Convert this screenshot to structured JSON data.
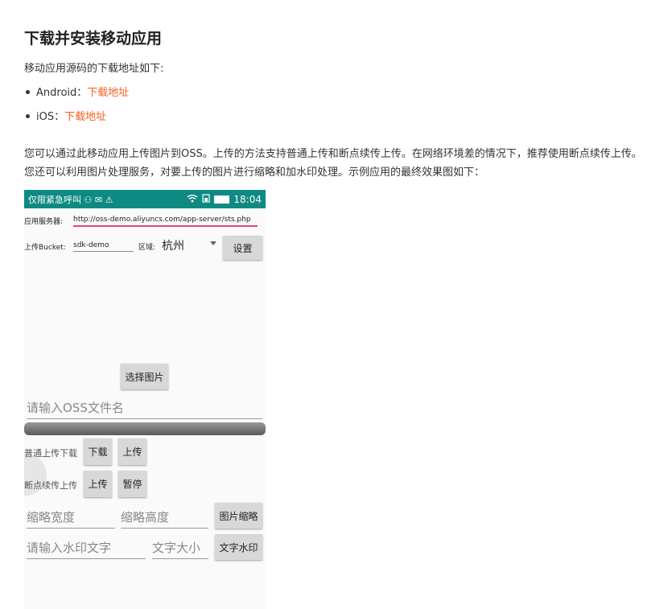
{
  "doc": {
    "heading": "下载并安装移动应用",
    "intro": "移动应用源码的下载地址如下:",
    "links": [
      {
        "platform": "Android：",
        "link": "下载地址"
      },
      {
        "platform": "iOS：",
        "link": "下载地址"
      }
    ],
    "description": "您可以通过此移动应用上传图片到OSS。上传的方法支持普通上传和断点续传上传。在网络环境差的情况下，推荐使用断点续传上传。您还可以利用图片处理服务，对要上传的图片进行缩略和加水印处理。示例应用的最终效果图如下：",
    "link_color": "#f4601e"
  },
  "phone": {
    "status_left": "仅限紧急呼叫 ⚇ ✉ ⚠",
    "status_time": "18:04",
    "status_color": "#0f8a83",
    "server_label": "应用服务器:",
    "server_url": "http://oss-demo.aliyuncs.com/app-server/sts.php",
    "bucket_label": "上传Bucket:",
    "bucket_value": "sdk-demo",
    "region_label": "区域:",
    "region_value": "杭州",
    "settings_button": "设置",
    "select_image_button": "选择图片",
    "filename_placeholder": "请输入OSS文件名",
    "normal_label": "普通上传下载",
    "download_button": "下载",
    "upload_button": "上传",
    "resume_label": "断点续传上传",
    "resume_upload_button": "上传",
    "pause_button": "暂停",
    "thumb_width_placeholder": "缩略宽度",
    "thumb_height_placeholder": "缩略高度",
    "thumb_button": "图片缩略",
    "watermark_placeholder": "请输入水印文字",
    "font_size_placeholder": "文字大小",
    "watermark_button": "文字水印"
  }
}
